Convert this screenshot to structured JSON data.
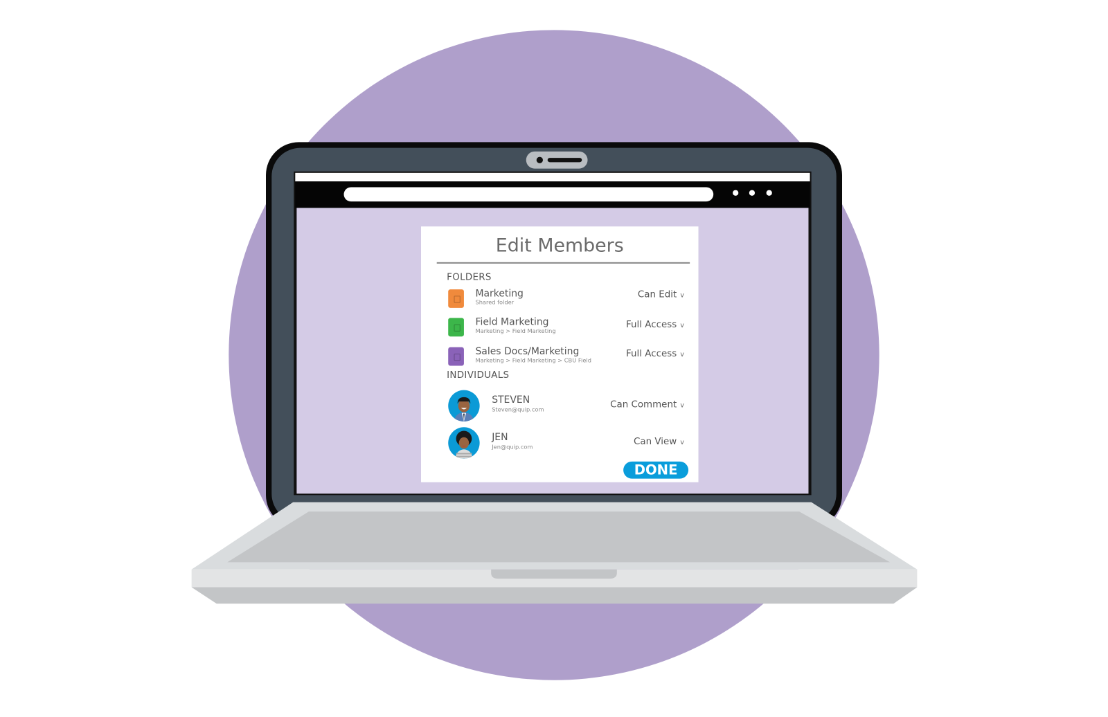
{
  "dialog": {
    "title": "Edit Members",
    "folders_heading": "FOLDERS",
    "folders": [
      {
        "name": "Marketing",
        "path": "Shared folder",
        "permission": "Can Edit",
        "color": "#f08a3c"
      },
      {
        "name": "Field Marketing",
        "path": "Marketing > Field Marketing",
        "permission": "Full Access",
        "color": "#3cb64a"
      },
      {
        "name": "Sales Docs/Marketing",
        "path": "Marketing > Field Marketing > CBU Field",
        "permission": "Full Access",
        "color": "#8a62b8"
      }
    ],
    "individuals_heading": "INDIVIDUALS",
    "individuals": [
      {
        "name": "STEVEN",
        "email": "Steven@quip.com",
        "permission": "Can Comment"
      },
      {
        "name": "JEN",
        "email": "Jen@quip.com",
        "permission": "Can View"
      }
    ],
    "done_label": "DONE",
    "chevron": "v"
  },
  "colors": {
    "background_circle": "#af9fcb",
    "screen_background": "#d4cbe6",
    "bezel": "#434f5a",
    "accent": "#0a9ddb"
  }
}
